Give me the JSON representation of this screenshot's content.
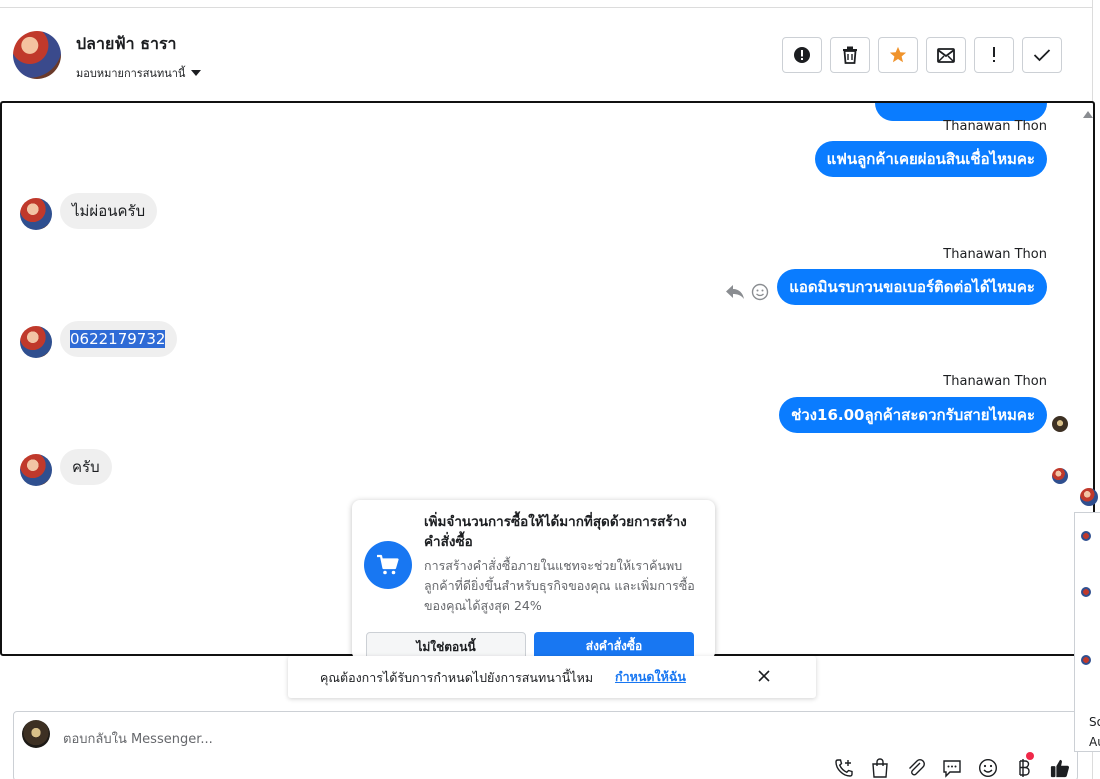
{
  "header": {
    "contact_name": "ปลายฟ้า ธารา",
    "assign_label": "มอบหมายการสนทนานี้",
    "toolbar": {
      "spam_icon": "alert-circle-icon",
      "delete_icon": "trash-icon",
      "star_icon": "star-icon",
      "mark_unread_icon": "mail-icon",
      "follow_up_icon": "exclamation-icon",
      "done_icon": "check-icon"
    }
  },
  "messages": {
    "sender_1": "Thanawan Thon",
    "msg_1": "แฟนลูกค้าเคยผ่อนสินเชื่อไหมคะ",
    "reply_1": "ไม่ผ่อนครับ",
    "sender_2": "Thanawan Thon",
    "msg_2": "แอดมินรบกวนขอเบอร์ติดต่อได้ไหมคะ",
    "reply_2": "0622179732",
    "sender_3": "Thanawan Thon",
    "msg_3": "ช่วง16.00ลูกค้าสะดวกรับสายไหมคะ",
    "reply_3": "ครับ"
  },
  "promo": {
    "title": "เพิ่มจำนวนการซื้อให้ได้มากที่สุดด้วยการสร้างคำสั่งซื้อ",
    "body": "การสร้างคำสั่งซื้อภายในแชทจะช่วยให้เราค้นพบลูกค้าที่ดียิ่งขึ้นสำหรับธุรกิจของคุณ และเพิ่มการซื้อของคุณได้สูงสุด 24%",
    "not_now": "ไม่ใช่ตอนนี้",
    "create_order": "ส่งคำสั่งซื้อ"
  },
  "banner": {
    "text": "คุณต้องการได้รับการกำหนดไปยังการสนทนานี้ไหม",
    "link": "กำหนดให้ฉัน"
  },
  "composer": {
    "placeholder": "ตอบกลับใน Messenger..."
  },
  "side_panel": {
    "line_1": "So",
    "line_2": "Au"
  },
  "colors": {
    "accent": "#0a7cff",
    "brand_blue": "#1877f2",
    "incoming_bubble": "#efefef",
    "selection": "#2f6bd6"
  }
}
